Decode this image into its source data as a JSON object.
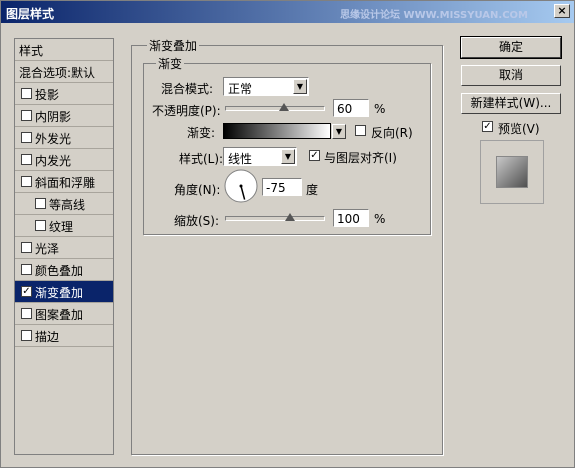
{
  "window": {
    "title": "图层样式",
    "watermark": "思缘设计论坛 WWW.MISSYUAN.COM",
    "close_glyph": "×"
  },
  "sidebar": {
    "items": [
      {
        "label": "样式",
        "checkbox": false,
        "checked": false,
        "selected": false
      },
      {
        "label": "混合选项:默认",
        "checkbox": false,
        "checked": false,
        "selected": false
      },
      {
        "label": "投影",
        "checkbox": true,
        "checked": false,
        "selected": false
      },
      {
        "label": "内阴影",
        "checkbox": true,
        "checked": false,
        "selected": false
      },
      {
        "label": "外发光",
        "checkbox": true,
        "checked": false,
        "selected": false
      },
      {
        "label": "内发光",
        "checkbox": true,
        "checked": false,
        "selected": false
      },
      {
        "label": "斜面和浮雕",
        "checkbox": true,
        "checked": false,
        "selected": false
      },
      {
        "label": "等高线",
        "checkbox": true,
        "checked": false,
        "selected": false
      },
      {
        "label": "纹理",
        "checkbox": true,
        "checked": false,
        "selected": false
      },
      {
        "label": "光泽",
        "checkbox": true,
        "checked": false,
        "selected": false
      },
      {
        "label": "颜色叠加",
        "checkbox": true,
        "checked": false,
        "selected": false
      },
      {
        "label": "渐变叠加",
        "checkbox": true,
        "checked": true,
        "selected": true
      },
      {
        "label": "图案叠加",
        "checkbox": true,
        "checked": false,
        "selected": false
      },
      {
        "label": "描边",
        "checkbox": true,
        "checked": false,
        "selected": false
      }
    ]
  },
  "panel": {
    "group_title": "渐变叠加",
    "sub_title": "渐变",
    "blend_mode_label": "混合模式:",
    "blend_mode_value": "正常",
    "opacity_label": "不透明度(P):",
    "opacity_value": "60",
    "opacity_unit": "%",
    "opacity_level": 60,
    "gradient_label": "渐变:",
    "reverse_label": "反向(R)",
    "reverse_checked": false,
    "style_label": "样式(L):",
    "style_value": "线性",
    "align_label": "与图层对齐(I)",
    "align_checked": true,
    "angle_label": "角度(N):",
    "angle_value": "-75",
    "angle_unit": "度",
    "scale_label": "缩放(S):",
    "scale_value": "100",
    "scale_unit": "%",
    "scale_level": 66
  },
  "buttons": {
    "ok": "确定",
    "cancel": "取消",
    "new_style": "新建样式(W)...",
    "preview_label": "预览(V)",
    "preview_checked": true
  },
  "check_glyph": "✓",
  "dropdown_glyph": "▼"
}
